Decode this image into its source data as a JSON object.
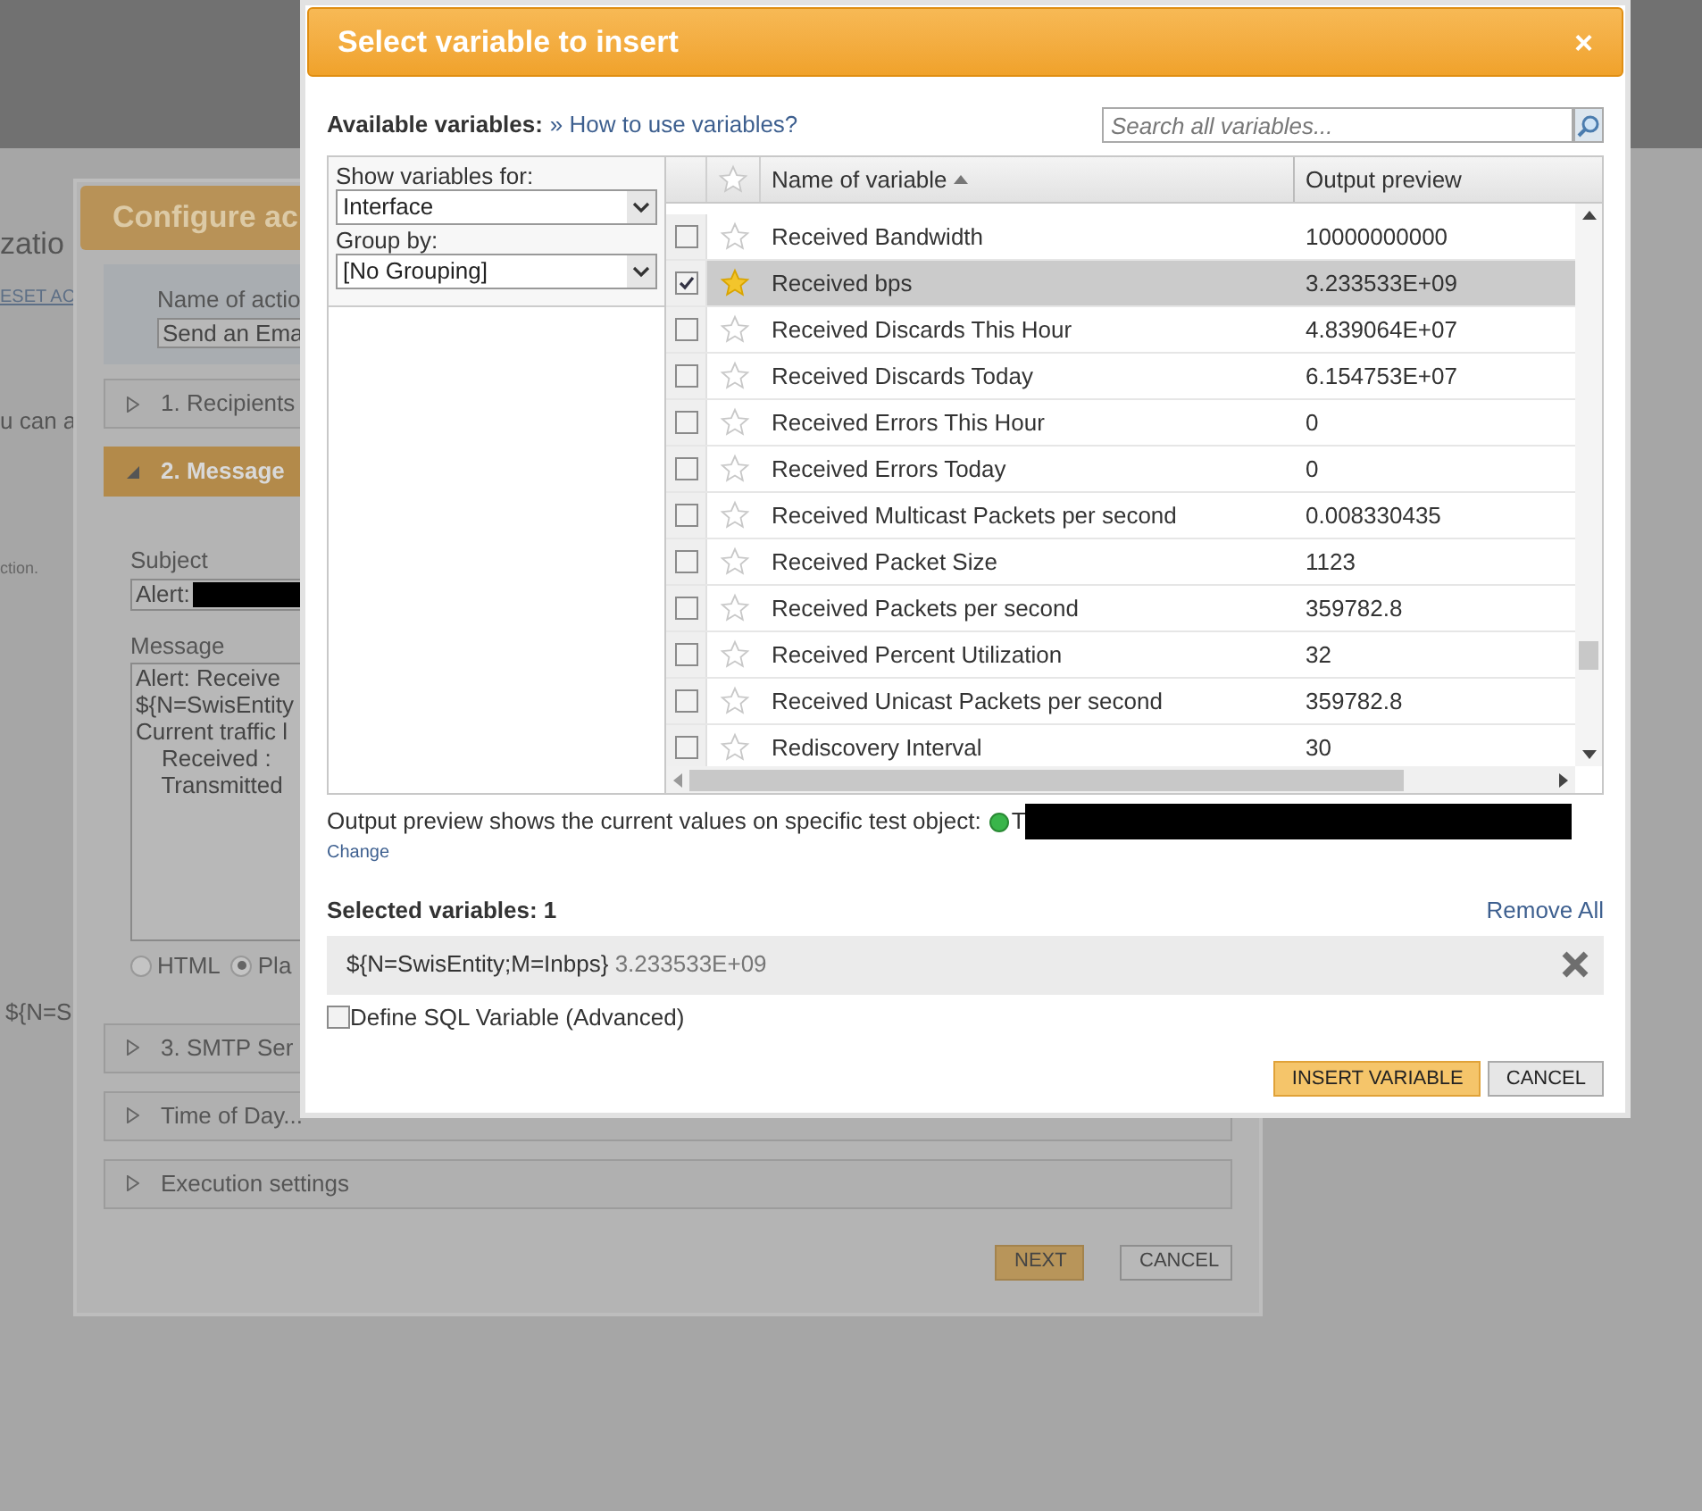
{
  "background_page": {
    "heading": "zatio",
    "link": "ESET AC",
    "line_1": "u can a",
    "line_2": "ction.",
    "line_3": "${N=S"
  },
  "configure_dialog": {
    "title": "Configure ac",
    "name_label": "Name of actio",
    "name_value": "Send an Ema",
    "sections": [
      {
        "label": "1. Recipients",
        "expanded": false
      },
      {
        "label": "2. Message",
        "expanded": true
      }
    ],
    "subject_label": "Subject",
    "subject_value": "Alert:",
    "message_label": "Message",
    "message_lines": [
      "Alert: Receive",
      "${N=SwisEntity",
      "Current traffic l",
      "    Received :",
      "    Transmitted"
    ],
    "formats": [
      {
        "label": "HTML",
        "selected": false
      },
      {
        "label": "Pla",
        "selected": true
      }
    ],
    "more_sections": [
      {
        "label": "3. SMTP Ser",
        "expanded": false
      },
      {
        "label": "Time of Day...",
        "expanded": false
      },
      {
        "label": "Execution settings",
        "expanded": false
      }
    ],
    "buttons": [
      {
        "label": "NEXT",
        "kind": "primary"
      },
      {
        "label": "CANCEL",
        "kind": "secondary"
      }
    ]
  },
  "variable_dialog": {
    "title": "Select variable to insert",
    "close": "×",
    "available_label": "Available variables:",
    "help_link": "» How to use variables?",
    "search": {
      "placeholder": "Search all variables..."
    },
    "show_label": "Show variables for:",
    "show_value": "Interface",
    "group_label": "Group by:",
    "group_value": "[No Grouping]",
    "columns": [
      {
        "label": "Name of variable",
        "sorted": true
      },
      {
        "label": "Output preview",
        "sorted": false
      }
    ],
    "rows": [
      {
        "name": "Received Bandwidth",
        "preview": "10000000000",
        "checked": false,
        "starred": false,
        "selected": false
      },
      {
        "name": "Received bps",
        "preview": "3.233533E+09",
        "checked": true,
        "starred": true,
        "selected": true
      },
      {
        "name": "Received Discards This Hour",
        "preview": "4.839064E+07",
        "checked": false,
        "starred": false,
        "selected": false
      },
      {
        "name": "Received Discards Today",
        "preview": "6.154753E+07",
        "checked": false,
        "starred": false,
        "selected": false
      },
      {
        "name": "Received Errors This Hour",
        "preview": "0",
        "checked": false,
        "starred": false,
        "selected": false
      },
      {
        "name": "Received Errors Today",
        "preview": "0",
        "checked": false,
        "starred": false,
        "selected": false
      },
      {
        "name": "Received Multicast Packets per second",
        "preview": "0.008330435",
        "checked": false,
        "starred": false,
        "selected": false
      },
      {
        "name": "Received Packet Size",
        "preview": "1123",
        "checked": false,
        "starred": false,
        "selected": false
      },
      {
        "name": "Received Packets per second",
        "preview": "359782.8",
        "checked": false,
        "starred": false,
        "selected": false
      },
      {
        "name": "Received Percent Utilization",
        "preview": "32",
        "checked": false,
        "starred": false,
        "selected": false
      },
      {
        "name": "Received Unicast Packets per second",
        "preview": "359782.8",
        "checked": false,
        "starred": false,
        "selected": false
      },
      {
        "name": "Rediscovery Interval",
        "preview": "30",
        "checked": false,
        "starred": false,
        "selected": false
      }
    ],
    "preview_note": "Output preview shows the current values on specific test object:",
    "test_object": "T",
    "change_link": "Change",
    "selected_title": "Selected variables: 1",
    "remove_all": "Remove All",
    "selected_items": [
      {
        "name": "${N=SwisEntity;M=Inbps}",
        "value": "3.233533E+09"
      }
    ],
    "sql_option": {
      "label": "Define SQL Variable (Advanced)",
      "checked": false
    },
    "buttons": [
      {
        "label": "INSERT VARIABLE",
        "kind": "primary"
      },
      {
        "label": "CANCEL",
        "kind": "secondary"
      }
    ]
  }
}
